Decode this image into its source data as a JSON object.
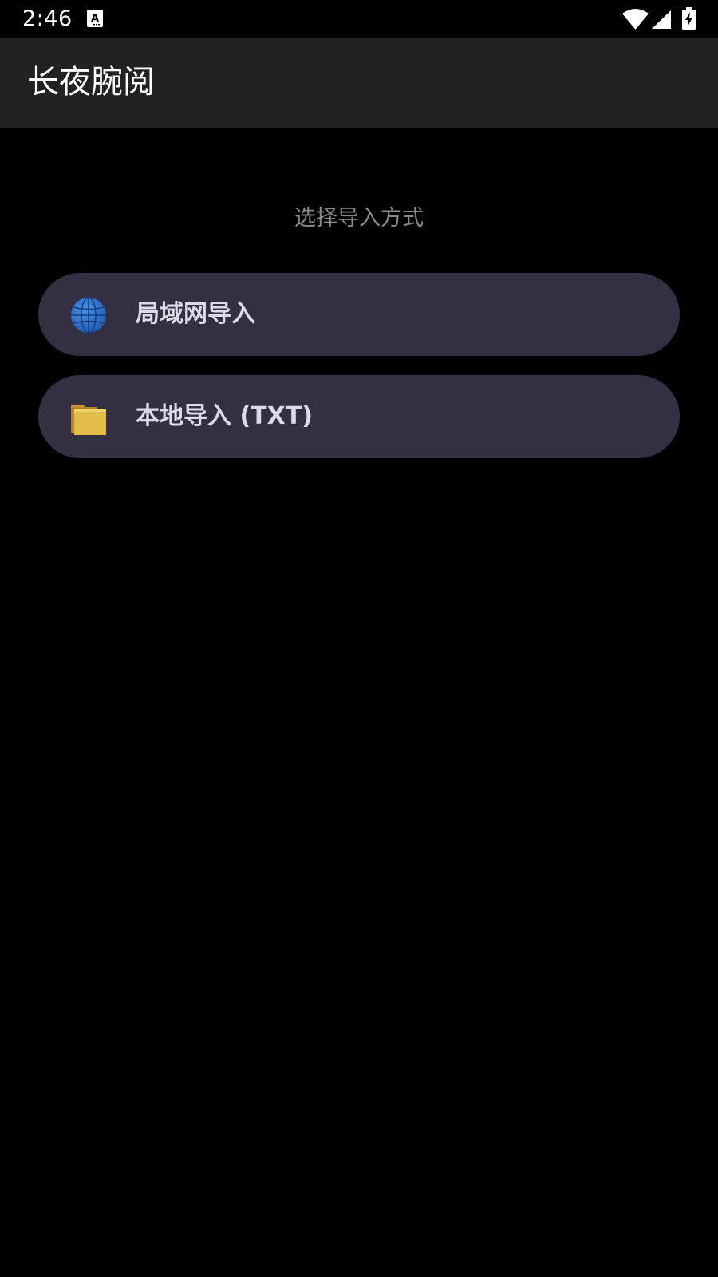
{
  "status_bar": {
    "time": "2:46",
    "icons": [
      "keyboard-a-icon",
      "wifi-icon",
      "cell-signal-icon",
      "battery-charging-icon"
    ]
  },
  "app_bar": {
    "title": "长夜腕阅"
  },
  "main": {
    "heading": "选择导入方式",
    "options": [
      {
        "label": "局域网导入",
        "icon": "globe-icon"
      },
      {
        "label": "本地导入 (TXT)",
        "icon": "folder-icon"
      }
    ]
  },
  "colors": {
    "background": "#000000",
    "app_bar": "#222222",
    "option_bg": "#342f43",
    "option_text": "#dcdbe6",
    "heading_text": "#8a8a8a"
  }
}
